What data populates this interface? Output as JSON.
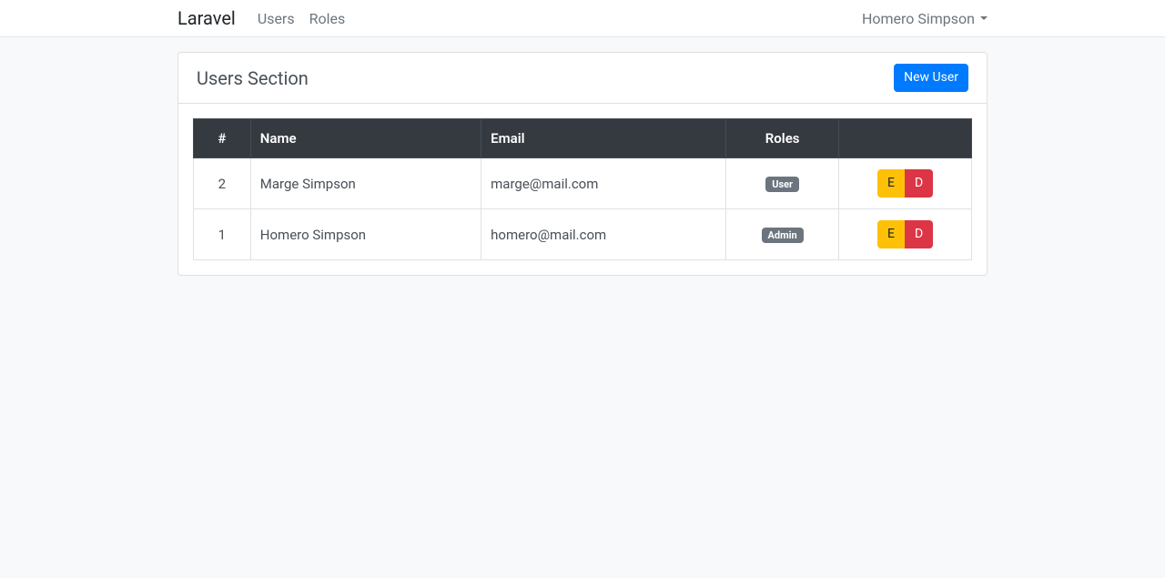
{
  "navbar": {
    "brand": "Laravel",
    "links": [
      {
        "label": "Users"
      },
      {
        "label": "Roles"
      }
    ],
    "user_name": "Homero Simpson"
  },
  "page": {
    "title": "Users Section",
    "new_button": "New User"
  },
  "table": {
    "headers": {
      "id": "#",
      "name": "Name",
      "email": "Email",
      "roles": "Roles"
    },
    "rows": [
      {
        "id": "2",
        "name": "Marge Simpson",
        "email": "marge@mail.com",
        "role": "User",
        "edit": "E",
        "delete": "D"
      },
      {
        "id": "1",
        "name": "Homero Simpson",
        "email": "homero@mail.com",
        "role": "Admin",
        "edit": "E",
        "delete": "D"
      }
    ]
  }
}
